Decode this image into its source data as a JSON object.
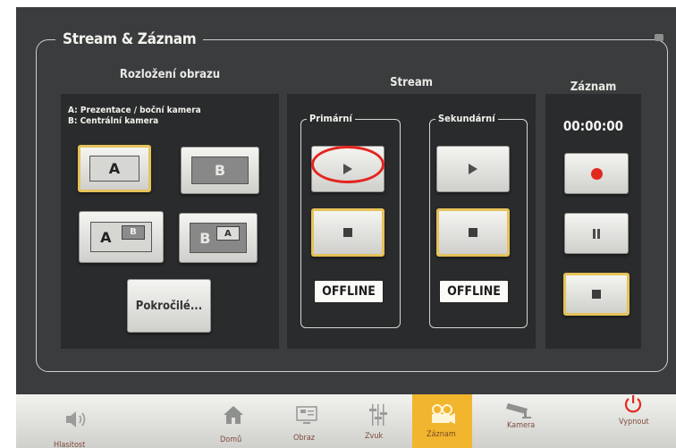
{
  "header": {
    "title": "Stream & Záznam"
  },
  "layout_panel": {
    "title": "Rozložení obrazu",
    "legend_line1": "A: Prezentace / boční kamera",
    "legend_line2": "B: Centrální kamera",
    "buttons": [
      {
        "label": "A",
        "selected": true
      },
      {
        "label": "B",
        "selected": false
      },
      {
        "main": "A",
        "pip": "B",
        "selected": false
      },
      {
        "main": "B",
        "pip": "A",
        "selected": false
      }
    ],
    "advanced_label": "Pokročilé..."
  },
  "stream_panel": {
    "title": "Stream",
    "primary": {
      "label": "Primární",
      "status": "OFFLINE",
      "stop_selected": true
    },
    "secondary": {
      "label": "Sekundární",
      "status": "OFFLINE",
      "stop_selected": true
    }
  },
  "record_panel": {
    "title": "Záznam",
    "timer": "00:00:00",
    "record_color": "#e2291f",
    "stop_selected": true
  },
  "nav": {
    "items": [
      {
        "label": "Hlasitost",
        "icon": "speaker-icon"
      },
      {
        "label": "Domů",
        "icon": "home-icon"
      },
      {
        "label": "Obraz",
        "icon": "screen-icon"
      },
      {
        "label": "Zvuk",
        "icon": "mixer-sliders-icon"
      },
      {
        "label": "Záznam",
        "icon": "camcorder-icon",
        "active": true
      },
      {
        "label": "Kamera",
        "icon": "security-camera-icon"
      },
      {
        "label": "Vypnout",
        "icon": "power-icon"
      }
    ],
    "active_color": "#f1b52e",
    "power_color": "#e2291f"
  },
  "annotation": {
    "color": "#e3241f"
  }
}
